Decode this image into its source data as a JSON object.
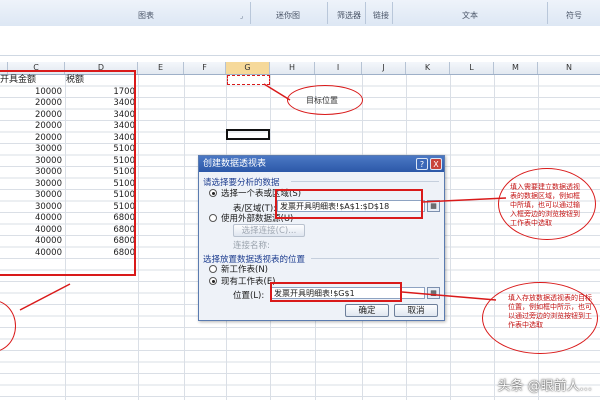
{
  "ribbon": {
    "groups": [
      "图表",
      "迷你图",
      "筛选器",
      "链接",
      "文本",
      "符号"
    ]
  },
  "columns": [
    "C",
    "D",
    "E",
    "F",
    "G",
    "H",
    "I",
    "J",
    "K",
    "L",
    "M",
    "N"
  ],
  "table": {
    "header_c": "开具金额",
    "header_d": "税额",
    "rows": [
      [
        "10000",
        "1700"
      ],
      [
        "20000",
        "3400"
      ],
      [
        "20000",
        "3400"
      ],
      [
        "20000",
        "3400"
      ],
      [
        "20000",
        "3400"
      ],
      [
        "30000",
        "5100"
      ],
      [
        "30000",
        "5100"
      ],
      [
        "30000",
        "5100"
      ],
      [
        "30000",
        "5100"
      ],
      [
        "30000",
        "5100"
      ],
      [
        "30000",
        "5100"
      ],
      [
        "40000",
        "6800"
      ],
      [
        "40000",
        "6800"
      ],
      [
        "40000",
        "6800"
      ],
      [
        "40000",
        "6800"
      ]
    ]
  },
  "annotations": {
    "target": "目标位置",
    "note1": "填入需要建立数据透视表的数据区域，例如框中所填，也可以通过输入框旁边的浏览按钮到工作表中选取",
    "note2": "填入存放数据透视表的目标位置，例如框中所示，也可以通过旁边的浏览按钮到工作表中选取"
  },
  "dialog": {
    "title": "创建数据透视表",
    "help": "?",
    "close": "X",
    "section1": "请选择要分析的数据",
    "opt_table": "选择一个表或区域(S)",
    "range_label": "表/区域(T):",
    "range_value": "发票开具明细表!$A$1:$D$18",
    "opt_external": "使用外部数据源(U)",
    "choose_conn": "选择连接(C)...",
    "conn_name": "连接名称:",
    "section2": "选择放置数据透视表的位置",
    "opt_new_sheet": "新工作表(N)",
    "opt_existing": "现有工作表(E)",
    "location_label": "位置(L):",
    "location_value": "发票开具明细表!$G$1",
    "ok": "确定",
    "cancel": "取消"
  },
  "watermark": "头条 @眼前人..."
}
